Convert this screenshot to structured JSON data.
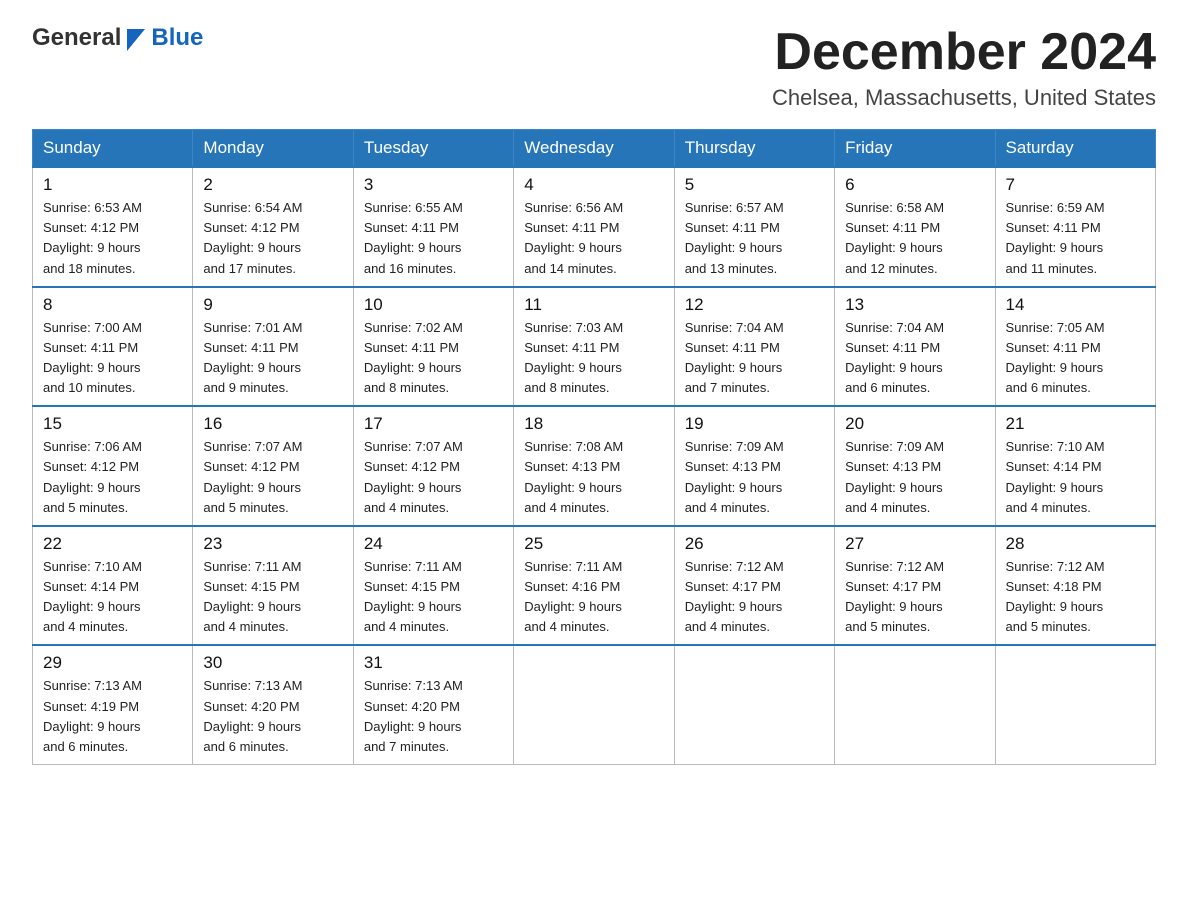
{
  "logo": {
    "general": "General",
    "blue": "Blue"
  },
  "title": "December 2024",
  "location": "Chelsea, Massachusetts, United States",
  "header": {
    "days": [
      "Sunday",
      "Monday",
      "Tuesday",
      "Wednesday",
      "Thursday",
      "Friday",
      "Saturday"
    ]
  },
  "weeks": [
    [
      {
        "day": "1",
        "sunrise": "6:53 AM",
        "sunset": "4:12 PM",
        "daylight": "9 hours and 18 minutes."
      },
      {
        "day": "2",
        "sunrise": "6:54 AM",
        "sunset": "4:12 PM",
        "daylight": "9 hours and 17 minutes."
      },
      {
        "day": "3",
        "sunrise": "6:55 AM",
        "sunset": "4:11 PM",
        "daylight": "9 hours and 16 minutes."
      },
      {
        "day": "4",
        "sunrise": "6:56 AM",
        "sunset": "4:11 PM",
        "daylight": "9 hours and 14 minutes."
      },
      {
        "day": "5",
        "sunrise": "6:57 AM",
        "sunset": "4:11 PM",
        "daylight": "9 hours and 13 minutes."
      },
      {
        "day": "6",
        "sunrise": "6:58 AM",
        "sunset": "4:11 PM",
        "daylight": "9 hours and 12 minutes."
      },
      {
        "day": "7",
        "sunrise": "6:59 AM",
        "sunset": "4:11 PM",
        "daylight": "9 hours and 11 minutes."
      }
    ],
    [
      {
        "day": "8",
        "sunrise": "7:00 AM",
        "sunset": "4:11 PM",
        "daylight": "9 hours and 10 minutes."
      },
      {
        "day": "9",
        "sunrise": "7:01 AM",
        "sunset": "4:11 PM",
        "daylight": "9 hours and 9 minutes."
      },
      {
        "day": "10",
        "sunrise": "7:02 AM",
        "sunset": "4:11 PM",
        "daylight": "9 hours and 8 minutes."
      },
      {
        "day": "11",
        "sunrise": "7:03 AM",
        "sunset": "4:11 PM",
        "daylight": "9 hours and 8 minutes."
      },
      {
        "day": "12",
        "sunrise": "7:04 AM",
        "sunset": "4:11 PM",
        "daylight": "9 hours and 7 minutes."
      },
      {
        "day": "13",
        "sunrise": "7:04 AM",
        "sunset": "4:11 PM",
        "daylight": "9 hours and 6 minutes."
      },
      {
        "day": "14",
        "sunrise": "7:05 AM",
        "sunset": "4:11 PM",
        "daylight": "9 hours and 6 minutes."
      }
    ],
    [
      {
        "day": "15",
        "sunrise": "7:06 AM",
        "sunset": "4:12 PM",
        "daylight": "9 hours and 5 minutes."
      },
      {
        "day": "16",
        "sunrise": "7:07 AM",
        "sunset": "4:12 PM",
        "daylight": "9 hours and 5 minutes."
      },
      {
        "day": "17",
        "sunrise": "7:07 AM",
        "sunset": "4:12 PM",
        "daylight": "9 hours and 4 minutes."
      },
      {
        "day": "18",
        "sunrise": "7:08 AM",
        "sunset": "4:13 PM",
        "daylight": "9 hours and 4 minutes."
      },
      {
        "day": "19",
        "sunrise": "7:09 AM",
        "sunset": "4:13 PM",
        "daylight": "9 hours and 4 minutes."
      },
      {
        "day": "20",
        "sunrise": "7:09 AM",
        "sunset": "4:13 PM",
        "daylight": "9 hours and 4 minutes."
      },
      {
        "day": "21",
        "sunrise": "7:10 AM",
        "sunset": "4:14 PM",
        "daylight": "9 hours and 4 minutes."
      }
    ],
    [
      {
        "day": "22",
        "sunrise": "7:10 AM",
        "sunset": "4:14 PM",
        "daylight": "9 hours and 4 minutes."
      },
      {
        "day": "23",
        "sunrise": "7:11 AM",
        "sunset": "4:15 PM",
        "daylight": "9 hours and 4 minutes."
      },
      {
        "day": "24",
        "sunrise": "7:11 AM",
        "sunset": "4:15 PM",
        "daylight": "9 hours and 4 minutes."
      },
      {
        "day": "25",
        "sunrise": "7:11 AM",
        "sunset": "4:16 PM",
        "daylight": "9 hours and 4 minutes."
      },
      {
        "day": "26",
        "sunrise": "7:12 AM",
        "sunset": "4:17 PM",
        "daylight": "9 hours and 4 minutes."
      },
      {
        "day": "27",
        "sunrise": "7:12 AM",
        "sunset": "4:17 PM",
        "daylight": "9 hours and 5 minutes."
      },
      {
        "day": "28",
        "sunrise": "7:12 AM",
        "sunset": "4:18 PM",
        "daylight": "9 hours and 5 minutes."
      }
    ],
    [
      {
        "day": "29",
        "sunrise": "7:13 AM",
        "sunset": "4:19 PM",
        "daylight": "9 hours and 6 minutes."
      },
      {
        "day": "30",
        "sunrise": "7:13 AM",
        "sunset": "4:20 PM",
        "daylight": "9 hours and 6 minutes."
      },
      {
        "day": "31",
        "sunrise": "7:13 AM",
        "sunset": "4:20 PM",
        "daylight": "9 hours and 7 minutes."
      },
      null,
      null,
      null,
      null
    ]
  ],
  "labels": {
    "sunrise": "Sunrise:",
    "sunset": "Sunset:",
    "daylight": "Daylight:"
  }
}
